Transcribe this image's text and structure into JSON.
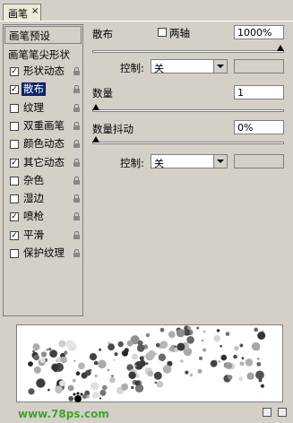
{
  "tab": {
    "title": "画笔",
    "close": "×"
  },
  "sidebar": {
    "presets": "画笔预设",
    "tip_shape": "画笔笔尖形状",
    "items": [
      {
        "label": "形状动态",
        "checked": true
      },
      {
        "label": "散布",
        "checked": true,
        "selected": true
      },
      {
        "label": "纹理",
        "checked": false
      },
      {
        "label": "双重画笔",
        "checked": false
      },
      {
        "label": "颜色动态",
        "checked": false
      },
      {
        "label": "其它动态",
        "checked": true
      },
      {
        "label": "杂色",
        "checked": false
      },
      {
        "label": "湿边",
        "checked": false
      },
      {
        "label": "喷枪",
        "checked": true
      },
      {
        "label": "平滑",
        "checked": true
      },
      {
        "label": "保护纹理",
        "checked": false
      }
    ]
  },
  "scatter": {
    "label": "散布",
    "both_axes": "两轴",
    "value": "1000%",
    "level": 1.0,
    "control_label": "控制:",
    "control_value": "关"
  },
  "count": {
    "label": "数量",
    "value": "1",
    "level": 0.0
  },
  "count_jitter": {
    "label": "数量抖动",
    "value": "0%",
    "level": 0.0,
    "control_label": "控制:",
    "control_value": "关"
  },
  "watermark": "www.78ps.com"
}
